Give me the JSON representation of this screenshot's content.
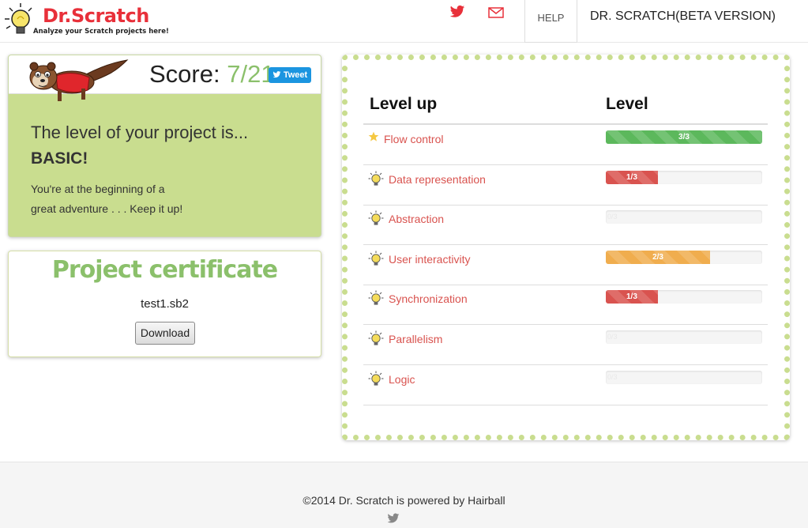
{
  "header": {
    "logo_text": "Dr.Scratch",
    "logo_subtitle": "Analyze your Scratch projects here!",
    "icons": [
      "twitter-icon",
      "mail-icon"
    ],
    "help_label": "HELP",
    "brand_right": "DR. SCRATCH(BETA VERSION)"
  },
  "score": {
    "label": "Score:",
    "value": "7/21",
    "tweet_label": "Tweet",
    "level_intro": "The level of your project is...",
    "level_name": "BASIC!",
    "message_line1": "You're at the beginning of a",
    "message_line2": "great adventure . . . Keep it up!"
  },
  "certificate": {
    "title": "Project certificate",
    "filename": "test1.sb2",
    "download_label": "Download"
  },
  "levels": {
    "col_levelup": "Level up",
    "col_level": "Level",
    "rows": [
      {
        "label": "Flow control",
        "icon": "star-icon",
        "score": "3/3",
        "fraction": 1.0,
        "color": "#5cb85c"
      },
      {
        "label": "Data representation",
        "icon": "lightbulb-icon",
        "score": "1/3",
        "fraction": 0.333,
        "color": "#d9534f"
      },
      {
        "label": "Abstraction",
        "icon": "lightbulb-icon",
        "score": "0/3",
        "fraction": 0,
        "color": "#d9534f"
      },
      {
        "label": "User interactivity",
        "icon": "lightbulb-icon",
        "score": "2/3",
        "fraction": 0.667,
        "color": "#f0ad4e"
      },
      {
        "label": "Synchronization",
        "icon": "lightbulb-icon",
        "score": "1/3",
        "fraction": 0.333,
        "color": "#d9534f"
      },
      {
        "label": "Parallelism",
        "icon": "lightbulb-icon",
        "score": "0/3",
        "fraction": 0,
        "color": "#d9534f"
      },
      {
        "label": "Logic",
        "icon": "lightbulb-icon",
        "score": "0/3",
        "fraction": 0,
        "color": "#d9534f"
      }
    ]
  },
  "footer": {
    "text": "©2014 Dr. Scratch is powered by Hairball",
    "icon": "twitter-icon"
  }
}
